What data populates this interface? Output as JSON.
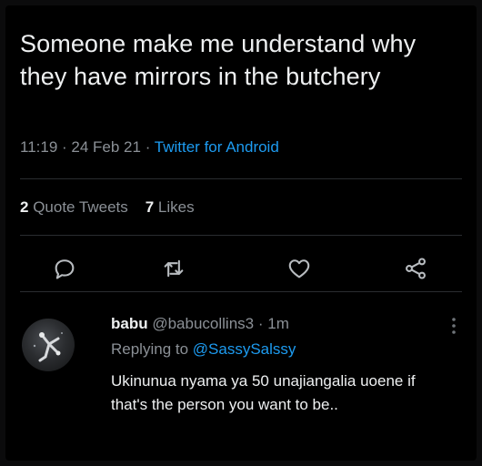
{
  "tweet": {
    "text": "Someone make me understand why they have mirrors in the butchery",
    "time": "11:19",
    "date": "24 Feb 21",
    "source": "Twitter for Android",
    "quote_count": "2",
    "quote_label": "Quote Tweets",
    "like_count": "7",
    "like_label": "Likes"
  },
  "actions": {
    "icons": [
      "reply-icon",
      "retweet-icon",
      "like-icon",
      "share-icon"
    ]
  },
  "reply": {
    "name": "babu",
    "handle": "@babucollins3",
    "time": "1m",
    "replying_prefix": "Replying to",
    "replying_handle": "@SassySalssy",
    "text": "Ukinunua nyama ya 50 unajiangalia uoene if that's the person you want to be.."
  },
  "colors": {
    "accent": "#1d9bf0",
    "muted": "#8b9096",
    "text": "#eef0f1",
    "background": "#000000"
  }
}
